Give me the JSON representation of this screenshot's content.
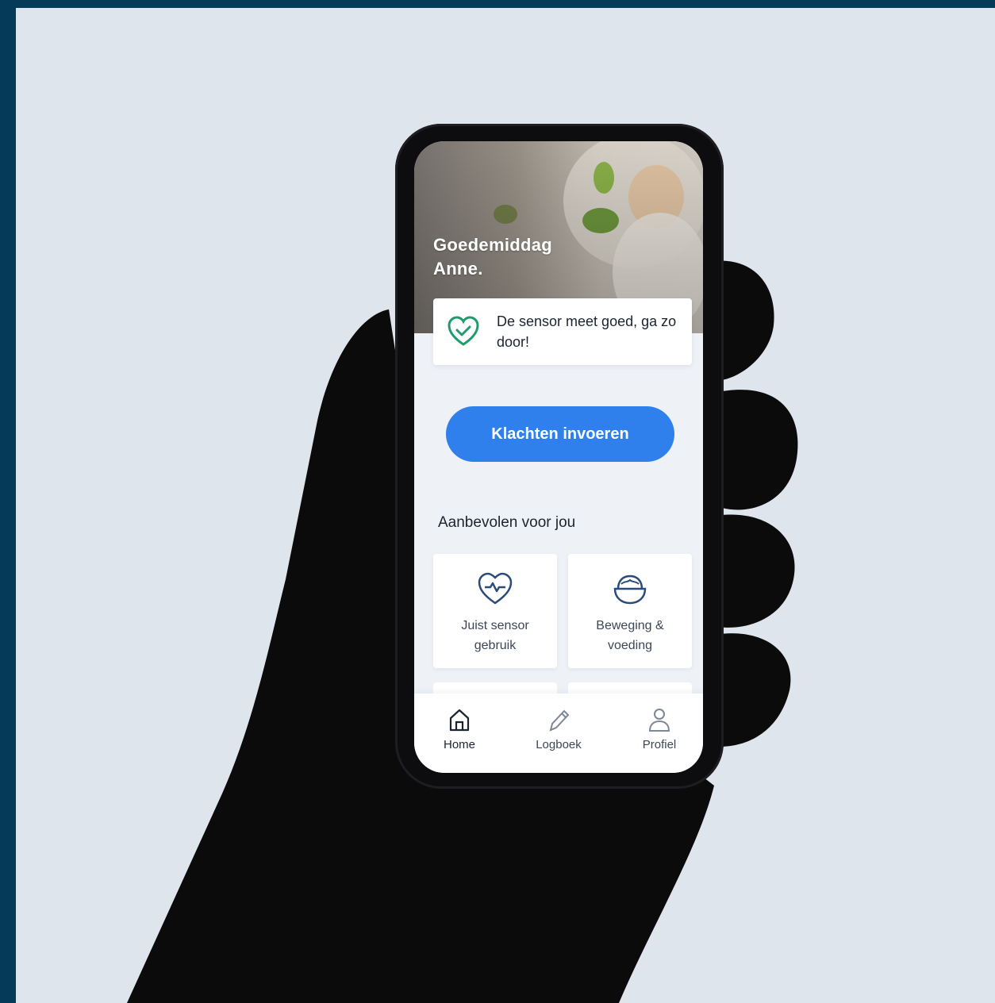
{
  "greeting": {
    "line1": "Goedemiddag",
    "line2": "Anne."
  },
  "status": {
    "icon": "heart-check-icon",
    "text": "De sensor meet goed, ga zo door!",
    "color": "#1f9c6b"
  },
  "cta": {
    "label": "Klachten invoeren",
    "color": "#2f80ed"
  },
  "recommended": {
    "title": "Aanbevolen voor jou",
    "items": [
      {
        "icon": "heart-pulse-icon",
        "label": "Juist sensor gebruik"
      },
      {
        "icon": "food-bowl-icon",
        "label": "Beweging & voeding"
      }
    ]
  },
  "tabbar": {
    "items": [
      {
        "icon": "home-icon",
        "label": "Home",
        "active": true
      },
      {
        "icon": "pencil-icon",
        "label": "Logboek",
        "active": false
      },
      {
        "icon": "person-icon",
        "label": "Profiel",
        "active": false
      }
    ]
  }
}
